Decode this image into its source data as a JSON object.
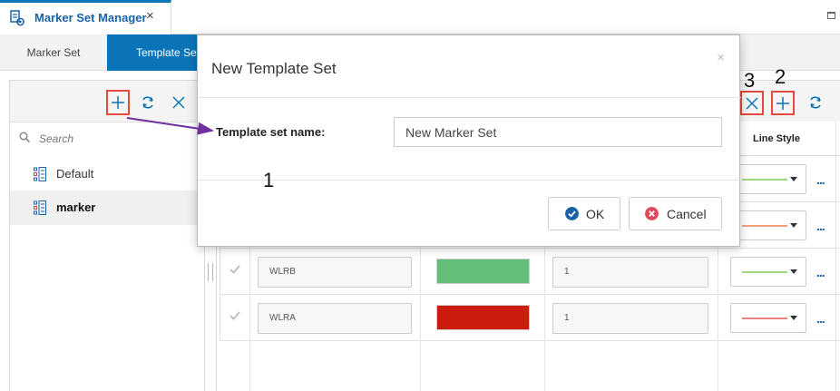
{
  "window": {
    "tab_title": "Marker Set Manager",
    "tab_close": "×",
    "icon": "marker-set-manager-icon"
  },
  "subtabs": [
    {
      "label": "Marker Set",
      "active": false
    },
    {
      "label": "Template Set",
      "active": true
    }
  ],
  "left_panel": {
    "toolbar": {
      "add_icon": "plus-icon",
      "refresh_icon": "refresh-icon",
      "delete_icon": "close-icon"
    },
    "search_placeholder": "Search",
    "items": [
      {
        "label": "Default",
        "selected": false
      },
      {
        "label": "marker",
        "selected": true
      }
    ]
  },
  "grid": {
    "toolbar": {
      "delete_icon": "close-icon",
      "add_icon": "plus-icon",
      "refresh_icon": "refresh-icon"
    },
    "columns": {
      "line_style": "Line Style"
    },
    "rows": [
      {
        "name": "",
        "color": "",
        "value": "",
        "line_color": "#9dd97e"
      },
      {
        "name": "",
        "color": "",
        "value": "",
        "line_color": "#f0a07d"
      },
      {
        "name": "WLRB",
        "color": "#62bf77",
        "value": "1",
        "line_color": "#9dd97e"
      },
      {
        "name": "WLRA",
        "color": "#cc1c0e",
        "value": "1",
        "line_color": "#e98080"
      }
    ],
    "more_label": "..."
  },
  "dialog": {
    "title": "New Template Set",
    "close": "×",
    "field_label": "Template set name:",
    "field_value": "New Marker Set",
    "ok_label": "OK",
    "cancel_label": "Cancel"
  },
  "annotations": {
    "one": "1",
    "two": "2",
    "three": "3",
    "box_color": "#e24a3b",
    "arrow_color": "#7030a0"
  }
}
